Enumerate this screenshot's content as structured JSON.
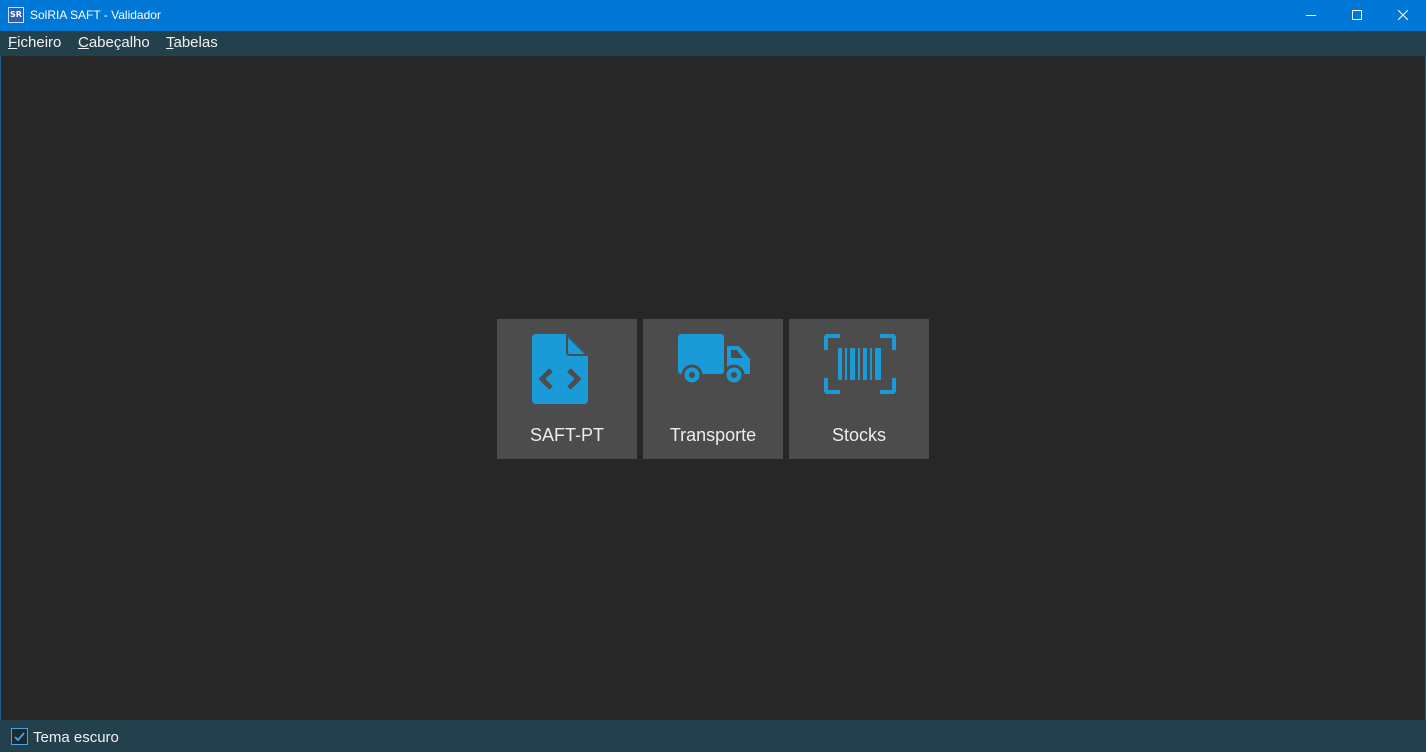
{
  "window": {
    "app_icon_text": "SR",
    "title": "SolRIA SAFT - Validador"
  },
  "menu": {
    "items": [
      {
        "accelerator": "F",
        "rest": "icheiro"
      },
      {
        "accelerator": "C",
        "rest": "abeçalho"
      },
      {
        "accelerator": "T",
        "rest": "abelas"
      }
    ]
  },
  "tiles": [
    {
      "label": "SAFT-PT",
      "icon": "code-file-icon"
    },
    {
      "label": "Transporte",
      "icon": "truck-icon"
    },
    {
      "label": "Stocks",
      "icon": "barcode-icon"
    }
  ],
  "footer": {
    "dark_theme_label": "Tema escuro",
    "dark_theme_checked": true
  },
  "colors": {
    "titlebar": "#0078d7",
    "menubar": "#23404d",
    "background": "#272727",
    "tile": "#4c4c4c",
    "icon_accent": "#1a9bd7"
  }
}
